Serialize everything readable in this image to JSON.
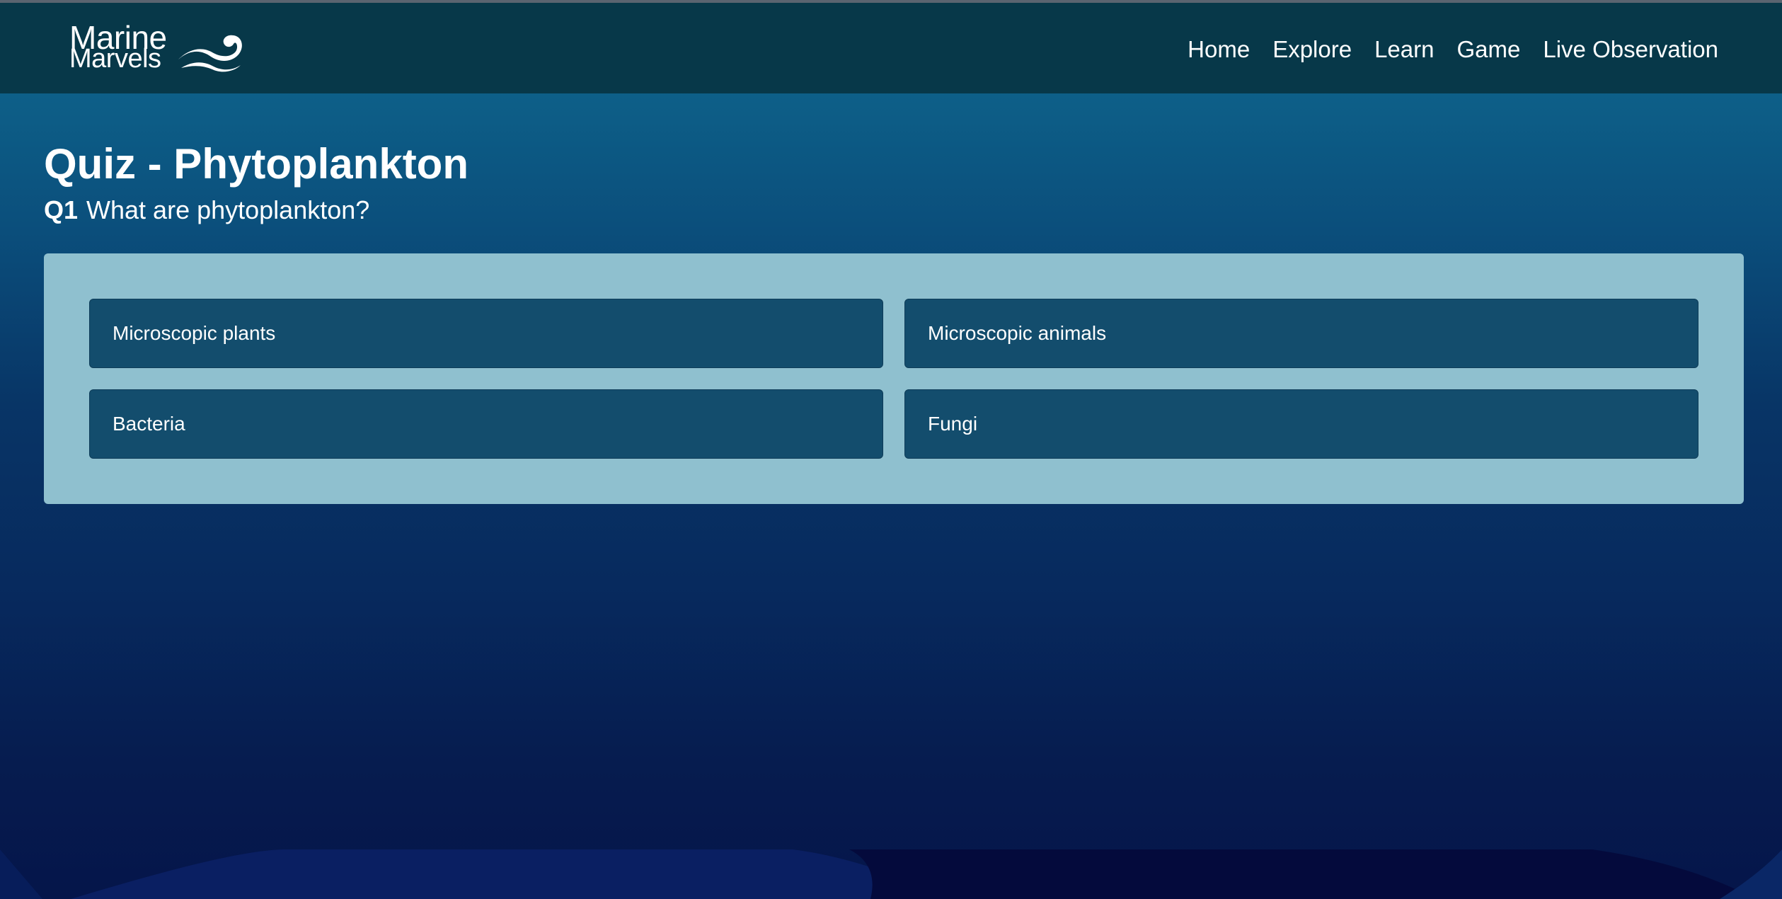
{
  "brand": {
    "line1": "Marine",
    "line2": "Marvels",
    "icon": "wave-icon"
  },
  "nav": {
    "items": [
      "Home",
      "Explore",
      "Learn",
      "Game",
      "Live Observation"
    ]
  },
  "quiz": {
    "title": "Quiz - Phytoplankton",
    "question_number": "Q1",
    "question_text": "What are phytoplankton?",
    "answers": [
      "Microscopic plants",
      "Microscopic animals",
      "Bacteria",
      "Fungi"
    ]
  },
  "colors": {
    "navbar": "#073849",
    "panel": "#8fc0cf",
    "answer_button": "#134d6d",
    "background_top": "#0f6b91",
    "background_bottom": "#05154a"
  }
}
